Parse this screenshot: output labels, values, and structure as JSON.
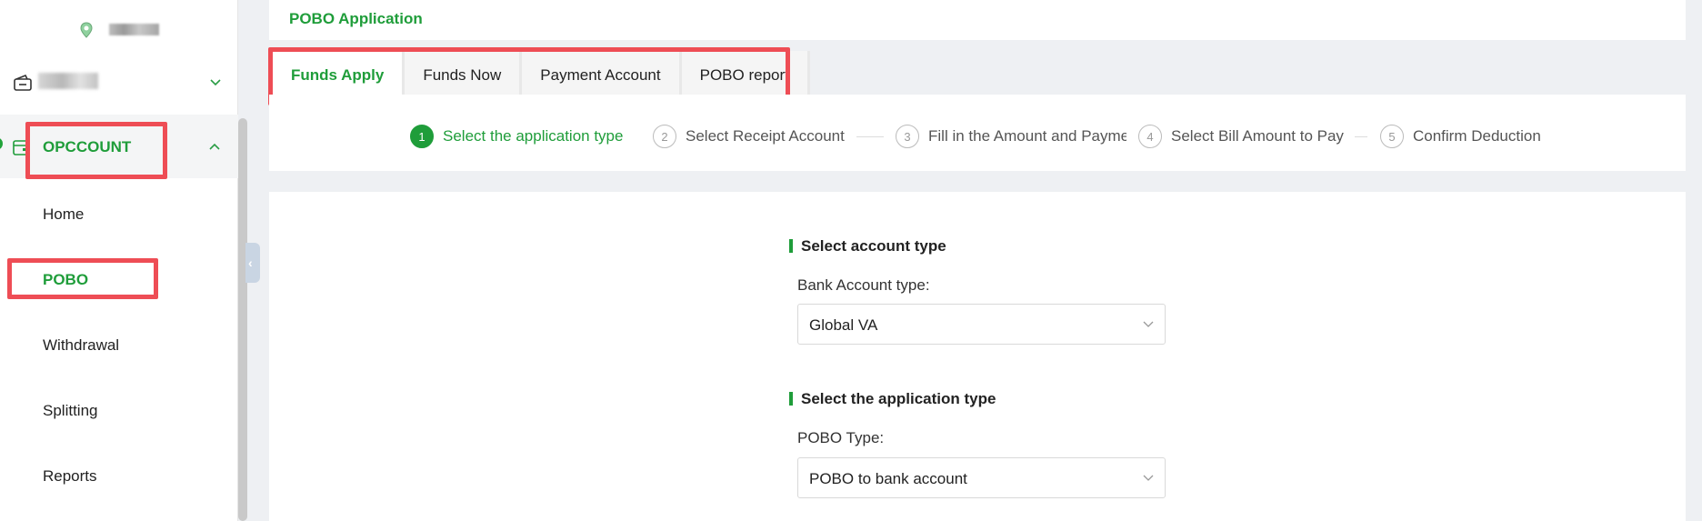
{
  "sidebar": {
    "org_label": "OPCCOUNT",
    "items": [
      {
        "label": "Home",
        "active": false
      },
      {
        "label": "POBO",
        "active": true
      },
      {
        "label": "Withdrawal",
        "active": false
      },
      {
        "label": "Splitting",
        "active": false
      },
      {
        "label": "Reports",
        "active": false
      }
    ]
  },
  "header": {
    "title": "POBO Application"
  },
  "tabs": [
    {
      "label": "Funds Apply",
      "active": true
    },
    {
      "label": "Funds Now",
      "active": false
    },
    {
      "label": "Payment Account",
      "active": false
    },
    {
      "label": "POBO report",
      "active": false
    }
  ],
  "steps": [
    {
      "num": "1",
      "label": "Select the application type",
      "active": true
    },
    {
      "num": "2",
      "label": "Select Receipt Account",
      "active": false
    },
    {
      "num": "3",
      "label": "Fill in the Amount and Payment",
      "active": false
    },
    {
      "num": "4",
      "label": "Select Bill Amount to Pay",
      "active": false
    },
    {
      "num": "5",
      "label": "Confirm Deduction",
      "active": false
    }
  ],
  "form": {
    "account_section_title": "Select account type",
    "account_type_label": "Bank Account type:",
    "account_type_value": "Global VA",
    "app_section_title": "Select the application type",
    "pobo_type_label": "POBO Type:",
    "pobo_type_value": "POBO to bank account"
  },
  "colors": {
    "accent": "#1f9d3a",
    "highlight": "#ee4d55"
  },
  "icons": [
    "location-pin-icon",
    "wallet-icon",
    "chevron-down-icon",
    "chevron-up-icon",
    "chevron-left-icon"
  ]
}
